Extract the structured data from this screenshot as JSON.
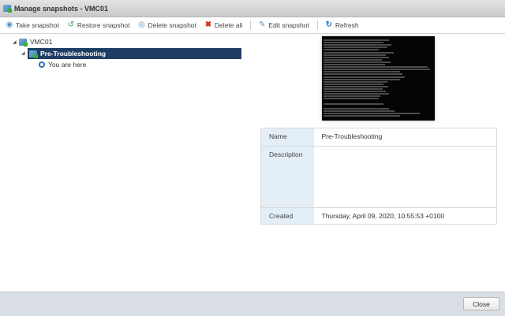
{
  "window": {
    "title": "Manage snapshots - VMC01"
  },
  "toolbar": {
    "take": "Take snapshot",
    "restore": "Restore snapshot",
    "delete": "Delete snapshot",
    "delete_all": "Delete all",
    "edit": "Edit snapshot",
    "refresh": "Refresh"
  },
  "tree": {
    "vm": "VMC01",
    "snapshot": "Pre-Troubleshooting",
    "current": "You are here"
  },
  "details": {
    "name_label": "Name",
    "name_value": "Pre-Troubleshooting",
    "description_label": "Description",
    "description_value": "",
    "created_label": "Created",
    "created_value": "Thursday, April 09, 2020, 10:55:53 +0100"
  },
  "footer": {
    "close": "Close"
  }
}
